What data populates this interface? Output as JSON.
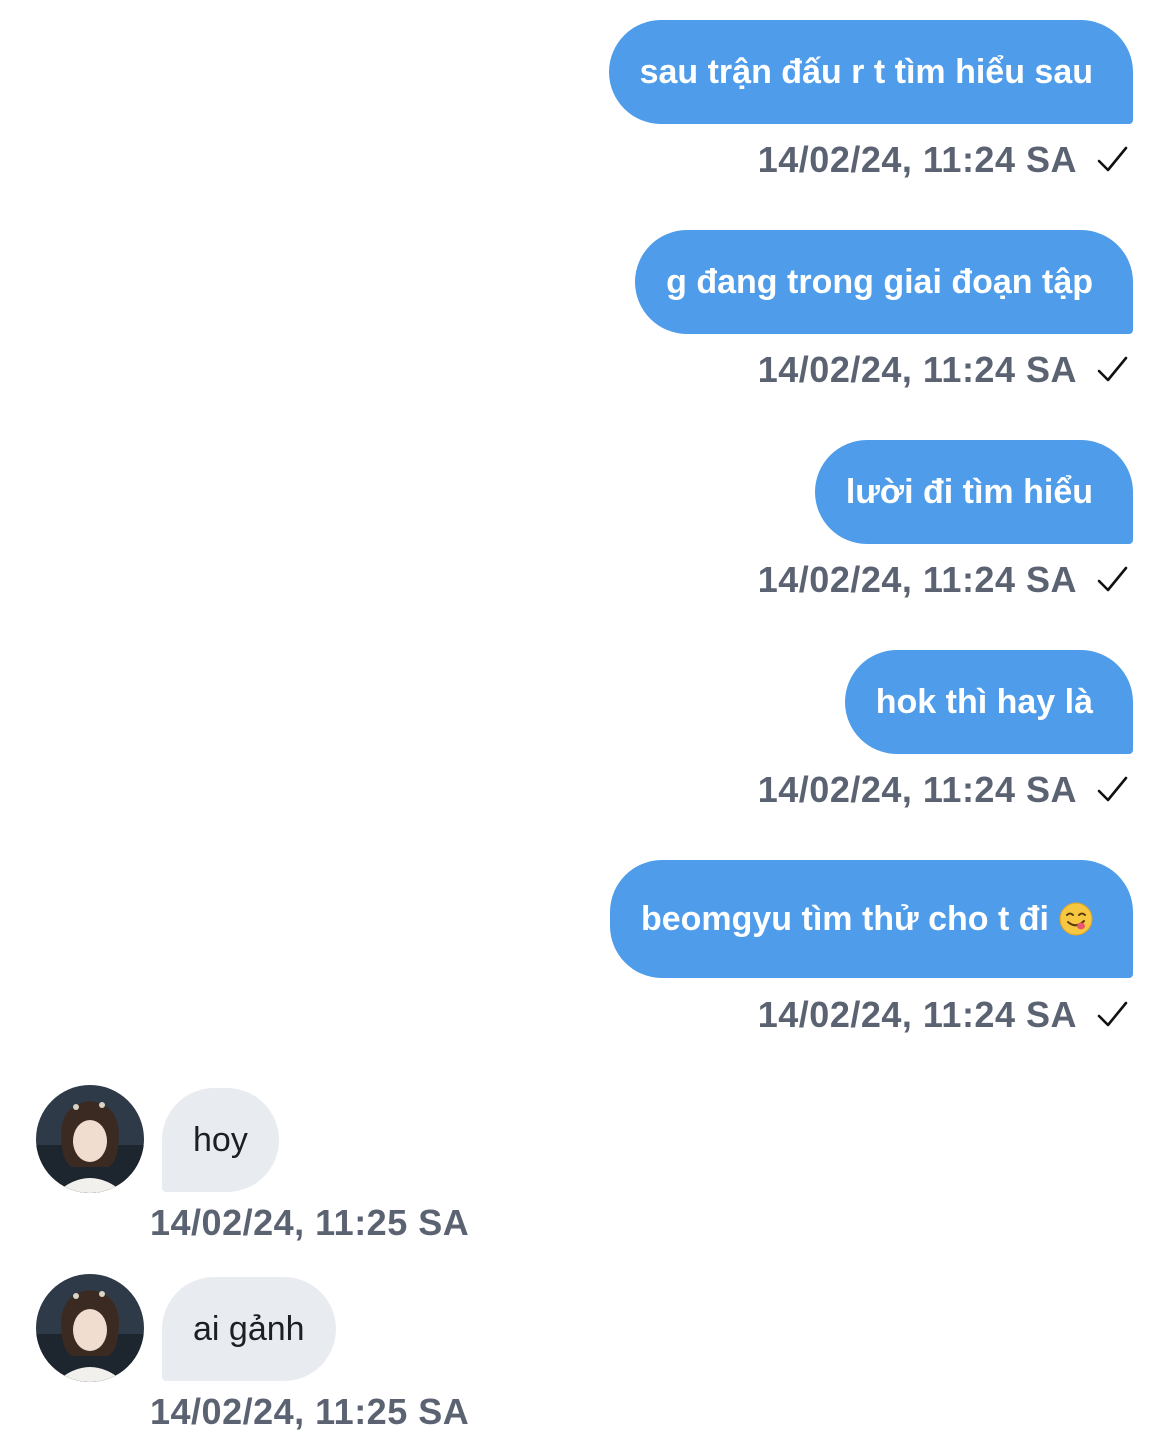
{
  "outgoing_messages": [
    {
      "text": "sau trận đấu r t tìm hiểu sau",
      "timestamp": "14/02/24, 11:24 SA",
      "status_icon": "check-icon"
    },
    {
      "text": "g đang trong giai đoạn tập",
      "timestamp": "14/02/24, 11:24 SA",
      "status_icon": "check-icon"
    },
    {
      "text": "lười đi tìm hiểu",
      "timestamp": "14/02/24, 11:24 SA",
      "status_icon": "check-icon"
    },
    {
      "text": "hok thì hay là",
      "timestamp": "14/02/24, 11:24 SA",
      "status_icon": "check-icon"
    },
    {
      "text": "beomgyu tìm thử cho t đi",
      "emoji": "face-savoring-food-emoji",
      "timestamp": "14/02/24, 11:24 SA",
      "status_icon": "check-icon"
    }
  ],
  "incoming_messages": [
    {
      "text": "hoy",
      "timestamp": "14/02/24, 11:25 SA",
      "avatar": "avatar"
    },
    {
      "text": "ai gảnh",
      "timestamp": "14/02/24, 11:25 SA",
      "avatar": "avatar"
    }
  ],
  "colors": {
    "outgoing_bubble": "#4e9cea",
    "incoming_bubble": "#e8ebf0",
    "timestamp": "#5b6373",
    "background": "#ffffff"
  }
}
